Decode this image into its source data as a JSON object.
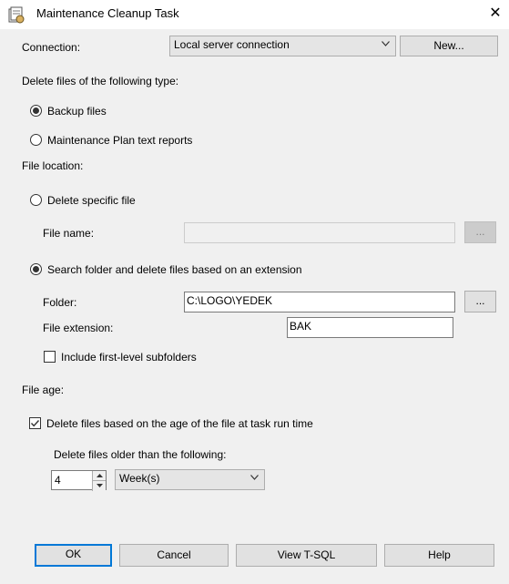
{
  "window": {
    "title": "Maintenance Cleanup Task",
    "icon": "task-icon",
    "close_icon": "close-icon"
  },
  "connection": {
    "label": "Connection:",
    "selected": "Local server connection",
    "new_button": "New..."
  },
  "file_type": {
    "heading": "Delete files of the following type:",
    "options": [
      {
        "label": "Backup files",
        "checked": true
      },
      {
        "label": "Maintenance Plan text reports",
        "checked": false
      }
    ]
  },
  "file_location": {
    "heading": "File location:",
    "delete_specific": {
      "label": "Delete specific file",
      "checked": false
    },
    "file_name": {
      "label": "File name:",
      "value": "",
      "browse": "..."
    },
    "search_folder": {
      "label": "Search folder and delete files based on an extension",
      "checked": true
    },
    "folder": {
      "label": "Folder:",
      "value": "C:\\LOGO\\YEDEK",
      "browse": "..."
    },
    "extension": {
      "label": "File extension:",
      "value": "BAK"
    },
    "subfolders": {
      "label": "Include first-level subfolders",
      "checked": false
    }
  },
  "file_age": {
    "heading": "File age:",
    "delete_by_age": {
      "label": "Delete files based on the age of the file at task run time",
      "checked": true
    },
    "older_than_label": "Delete files older than the following:",
    "amount": "4",
    "unit": "Week(s)"
  },
  "buttons": {
    "ok": "OK",
    "cancel": "Cancel",
    "view_tsql": "View T-SQL",
    "help": "Help"
  },
  "colors": {
    "accent": "#0078d7",
    "background": "#f0f0f0"
  }
}
